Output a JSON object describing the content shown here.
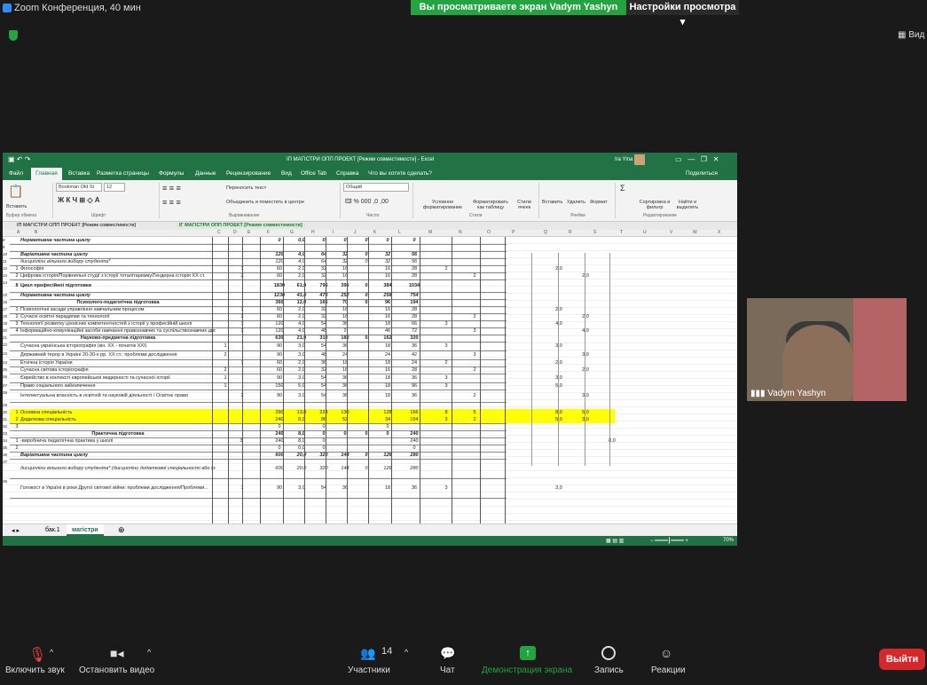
{
  "zoom": {
    "window_title": "Zoom Конференция, 40 мин",
    "share_banner": "Вы просматриваете экран Vadym Yashyn",
    "view_options": "Настройки просмотра",
    "view_button": "Вид",
    "participant_name": "Vadym Yashyn",
    "participants_count": "14",
    "toolbar": {
      "mute": "Включить звук",
      "video": "Остановить видео",
      "participants": "Участники",
      "chat": "Чат",
      "share": "Демонстрация экрана",
      "record": "Запись",
      "reactions": "Реакции",
      "leave": "Выйти"
    },
    "colors": {
      "green": "#23a342",
      "leave": "#d6282b",
      "excel": "#217346"
    }
  },
  "excel": {
    "title": "ІП МАГІСТРИ ОПП ПРОЕКТ [Режим совместимости] - Excel",
    "user": "Ira Yina",
    "tabs": [
      "Файл",
      "Главная",
      "Вставка",
      "Разметка страницы",
      "Формулы",
      "Данные",
      "Рецензирование",
      "Вид",
      "Office Tab",
      "Справка",
      "Что вы хотите сделать?"
    ],
    "share": "Поделиться",
    "ribbon": {
      "paste": "Вставить",
      "clipboard": "Буфер обмена",
      "font_name": "Bookman Old St",
      "font_size": "12",
      "font_group": "Шрифт",
      "wrap": "Переносить текст",
      "merge": "Объединить и поместить в центре",
      "align_group": "Выравнивание",
      "number_format": "Общий",
      "number_group": "Число",
      "cond": "Условное форматирование",
      "table": "Форматировать как таблицу",
      "styles": "Стили ячеек",
      "styles_group": "Стили",
      "insert": "Вставить",
      "delete": "Удалить",
      "format": "Формат",
      "cells_group": "Ячейки",
      "sort": "Сортировка и фильтр",
      "find": "Найти и выделить",
      "edit_group": "Редактирование"
    },
    "doc_tabs": [
      "ІП МАГІСТРИ ОПП ПРОЕКТ [Режим совместимости]",
      "ІГ МАГІСТРИ ОПП ПРОЕКТ [Режим совместимости]"
    ],
    "columns": [
      "A",
      "B",
      "C",
      "D",
      "E",
      "F",
      "G",
      "H",
      "I",
      "J",
      "K",
      "L",
      "M",
      "N",
      "O",
      "P",
      "Q",
      "R",
      "S",
      "T",
      "U",
      "V",
      "W",
      "X"
    ],
    "rows": [
      {
        "n": "8",
        "a": "Нормативна частина циклу",
        "f": "0",
        "g": "0,0",
        "h": "0",
        "i": "0",
        "j": "0",
        "k": "0",
        "l": "0",
        "cls": "bold ital"
      },
      {
        "n": "9"
      },
      {
        "n": "10",
        "a": "Варіативна частина циклу",
        "f": "120",
        "g": "4,0",
        "h": "64",
        "i": "32",
        "j": "0",
        "k": "32",
        "l": "56",
        "cls": "bold ital"
      },
      {
        "n": "11",
        "a": "дисципліни вільного вибору студента*",
        "f": "120",
        "g": "4,0",
        "h": "64",
        "i": "32",
        "j": "0",
        "k": "32",
        "l": "56",
        "cls": "ital"
      },
      {
        "n": "12",
        "num": "1",
        "a": "Філософія",
        "c": "1",
        "f": "60",
        "g": "2,0",
        "h": "32",
        "i": "16",
        "k": "16",
        "l": "28",
        "m": "2",
        "q": "2,0"
      },
      {
        "n": "13",
        "num": "2",
        "a": "Цифрова історія/Порівняльні студії з історії тоталітаризму/Гендерна історія XX ст.",
        "c": "2",
        "f": "60",
        "g": "2,0",
        "h": "32",
        "i": "16",
        "k": "16",
        "l": "28",
        "n2": "2",
        "r": "2,0"
      },
      {
        "n": "14",
        "num": "ІІ",
        "a": "Цикл професійної підготовки",
        "f": "1830",
        "g": "61,0",
        "h": "796",
        "i": "396",
        "j": "0",
        "k": "384",
        "l": "1034",
        "cls": "bold"
      },
      {
        "n": "15",
        "a": "Нормативна частина циклу",
        "f": "1230",
        "g": "41,0",
        "h": "476",
        "i": "252",
        "j": "0",
        "k": "258",
        "l": "754",
        "cls": "bold ital"
      },
      {
        "n": "16",
        "a": "Психолого-педагогічна підготовка",
        "f": "360",
        "g": "12,0",
        "h": "166",
        "i": "70",
        "j": "0",
        "k": "96",
        "l": "194",
        "cls": "bold"
      },
      {
        "n": "17",
        "num": "1",
        "a": "Психологічні засади управління навчальним процесом",
        "c": "1",
        "f": "60",
        "g": "2,0",
        "h": "32",
        "i": "16",
        "k": "16",
        "l": "28",
        "q": "2,0"
      },
      {
        "n": "18",
        "num": "2",
        "a": "Сучасні освітні парадигми та технології",
        "c": "2",
        "f": "60",
        "g": "2,0",
        "h": "32",
        "i": "16",
        "k": "16",
        "l": "28",
        "n2": "2",
        "r": "2,0"
      },
      {
        "n": "19",
        "num": "3",
        "a": "Технології розвитку ціннісних компетентностей з історії у професійній школі",
        "c": "1",
        "f": "120",
        "g": "4,0",
        "h": "54",
        "i": "36",
        "k": "18",
        "l": "66",
        "m": "3",
        "q": "4,0"
      },
      {
        "n": "20",
        "num": "4",
        "a": "Інформаційно-комунікаційні засоби навчання правознавчих та суспільствознавчих дисциплін",
        "c": "2",
        "f": "120",
        "g": "4,0",
        "h": "48",
        "i": "2",
        "k": "46",
        "l": "72",
        "n2": "3",
        "r": "4,0"
      },
      {
        "n": "21",
        "a": "Науково-предметна підготовка",
        "f": "630",
        "g": "21,0",
        "h": "310",
        "i": "182",
        "j": "0",
        "k": "162",
        "l": "320",
        "cls": "bold"
      },
      {
        "n": "22",
        "a": "Сучасна українська історіографія (кін. XX - початок XXI)",
        "b": "1",
        "f": "90",
        "g": "3,0",
        "h": "54",
        "i": "36",
        "k": "18",
        "l": "36",
        "m": "3",
        "q": "3,0"
      },
      {
        "n": "23",
        "a": "Державний терор в Україні 20-30-х рр. XX ст.: проблеми дослідження",
        "b": "2",
        "f": "90",
        "g": "3,0",
        "h": "48",
        "i": "24",
        "k": "24",
        "l": "42",
        "n2": "3",
        "r": "3,0"
      },
      {
        "n": "24",
        "a": "Етнічна історія України",
        "c": "1",
        "f": "60",
        "g": "2,0",
        "h": "36",
        "i": "18",
        "k": "18",
        "l": "24",
        "m": "2",
        "q": "2,0"
      },
      {
        "n": "25",
        "a": "Сучасна світова історіографія",
        "b": "2",
        "f": "60",
        "g": "2,0",
        "h": "32",
        "i": "16",
        "k": "16",
        "l": "28",
        "n2": "2",
        "r": "2,0"
      },
      {
        "n": "26",
        "a": "Єврейство в контексті європейської модерності та сучасної історії",
        "b": "1",
        "f": "90",
        "g": "3,0",
        "h": "54",
        "i": "36",
        "k": "18",
        "l": "36",
        "m": "3",
        "q": "3,0"
      },
      {
        "n": "27",
        "a": "Право соціального забезпечення",
        "b": "1",
        "f": "150",
        "g": "5,0",
        "h": "54",
        "i": "36",
        "k": "18",
        "l": "96",
        "m": "3",
        "q": "5,0"
      },
      {
        "n": "28",
        "a": "Інтелектуальна власність в освітній та науковій діяльності / Освітнє право",
        "c": "2",
        "f": "90",
        "g": "3,0",
        "h": "54",
        "i": "36",
        "k": "18",
        "l": "36",
        "n2": "2",
        "r": "3,0"
      },
      {
        "n": "29"
      },
      {
        "n": "30",
        "num": "1",
        "a": "Основна спеціальність",
        "f": "390",
        "g": "13,0",
        "h": "224",
        "i": "130",
        "k": "128",
        "l": "166",
        "m": "8",
        "n2": "5",
        "q": "8,0",
        "r": "5,0",
        "cls": "yellow"
      },
      {
        "n": "31",
        "num": "2",
        "a": "Додаткова спеціальність",
        "f": "240",
        "g": "8,0",
        "h": "86",
        "i": "52",
        "k": "34",
        "l": "154",
        "m": "3",
        "n2": "2",
        "q": "5,0",
        "r": "3,0",
        "cls": "yellow"
      },
      {
        "n": "32",
        "num": "3",
        "f": "0",
        "h": "0",
        "k": "0"
      },
      {
        "n": "33",
        "a": "Практична підготовка",
        "f": "240",
        "g": "8,0",
        "h": "0",
        "i": "0",
        "j": "0",
        "k": "0",
        "l": "240",
        "cls": "bold"
      },
      {
        "n": "34",
        "num": "1",
        "a": "-виробнича педагогічна практика у школі",
        "d": "3",
        "f": "240",
        "g": "8,0",
        "h": "0",
        "l": "240",
        "s": "8,0"
      },
      {
        "n": "35",
        "num": "2",
        "f": "0",
        "g": "0,0",
        "h": "0",
        "l": "0"
      },
      {
        "n": "36",
        "a": "Варіативна частина циклу",
        "f": "600",
        "g": "20,0",
        "h": "320",
        "i": "144",
        "j": "0",
        "k": "126",
        "l": "280",
        "cls": "bold ital"
      },
      {
        "n": "37",
        "a": "дисципліни вільного вибору студента* (дисципліни додаткової спеціальності або спеціалізації)",
        "f": "600",
        "g": "20,0",
        "h": "320",
        "i": "144",
        "j": "0",
        "k": "126",
        "l": "280",
        "cls": "ital"
      },
      {
        "n": "38",
        "a": "Голокост в Україні в роки Другої світової війни: проблеми дослідження/Проблеми...",
        "c": "1",
        "f": "90",
        "g": "3,0",
        "h": "54",
        "i": "36",
        "k": "18",
        "l": "36",
        "m": "3",
        "q": "3,0"
      }
    ],
    "sheets": [
      "бак.1",
      "магістри"
    ],
    "zoom_level": "70%"
  }
}
